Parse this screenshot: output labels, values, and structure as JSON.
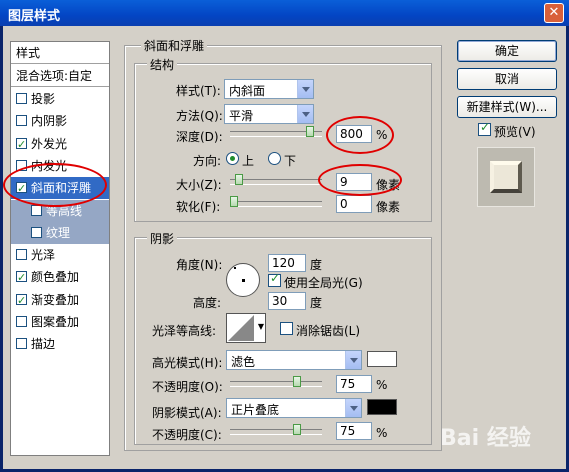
{
  "window": {
    "title": "图层样式",
    "close": "✕"
  },
  "stylelist": {
    "header": "样式",
    "blend": "混合选项:自定",
    "items": [
      {
        "label": "投影",
        "checked": false
      },
      {
        "label": "内阴影",
        "checked": false
      },
      {
        "label": "外发光",
        "checked": true
      },
      {
        "label": "内发光",
        "checked": false
      },
      {
        "label": "斜面和浮雕",
        "checked": true
      },
      {
        "label": "等高线",
        "checked": false
      },
      {
        "label": "纹理",
        "checked": false
      },
      {
        "label": "光泽",
        "checked": false
      },
      {
        "label": "颜色叠加",
        "checked": true
      },
      {
        "label": "渐变叠加",
        "checked": true
      },
      {
        "label": "图案叠加",
        "checked": false
      },
      {
        "label": "描边",
        "checked": false
      }
    ]
  },
  "bevel": {
    "title": "斜面和浮雕",
    "structure": {
      "title": "结构",
      "style_label": "样式(T):",
      "style_value": "内斜面",
      "method_label": "方法(Q):",
      "method_value": "平滑",
      "depth_label": "深度(D):",
      "depth_value": "800",
      "depth_unit": "%",
      "depth_level": 0.9,
      "direction_label": "方向:",
      "dir_up": "上",
      "dir_down": "下",
      "size_label": "大小(Z):",
      "size_value": "9",
      "size_unit": "像素",
      "size_level": 0.06,
      "soften_label": "软化(F):",
      "soften_value": "0",
      "soften_unit": "像素",
      "soften_level": 0
    },
    "shading": {
      "title": "阴影",
      "angle_label": "角度(N):",
      "angle_value": "120",
      "angle_unit": "度",
      "global_light": "使用全局光(G)",
      "altitude_label": "高度:",
      "altitude_value": "30",
      "altitude_unit": "度",
      "gloss_label": "光泽等高线:",
      "antialias": "消除锯齿(L)",
      "highlight_label": "高光模式(H):",
      "highlight_value": "滤色",
      "highlight_color": "#ffffff",
      "hl_opacity_label": "不透明度(O):",
      "hl_opacity_value": "75",
      "hl_opacity_unit": "%",
      "hl_opacity_level": 0.75,
      "shadow_label": "阴影模式(A):",
      "shadow_value": "正片叠底",
      "shadow_color": "#000000",
      "sh_opacity_label": "不透明度(C):",
      "sh_opacity_value": "75",
      "sh_opacity_unit": "%",
      "sh_opacity_level": 0.75
    }
  },
  "buttons": {
    "ok": "确定",
    "cancel": "取消",
    "new_style": "新建样式(W)...",
    "preview": "预览(V)"
  },
  "watermark": "Bai 经验"
}
